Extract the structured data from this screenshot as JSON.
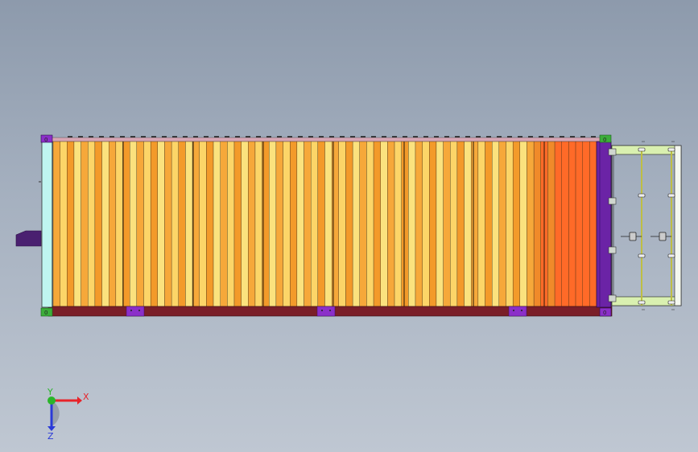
{
  "viewport": {
    "background_top": "#8d9aac",
    "background_bottom": "#bfc7d2"
  },
  "model": {
    "container_frame_color": "#7a1e28",
    "corner_block_color": "#3cae3a",
    "end_panel_color": "#6b23a6",
    "left_end_panel_color": "#bff5f0",
    "fitting_color": "#8b2fc9",
    "slat_palette": [
      "#f6a83a",
      "#fcd568",
      "#f39a2a",
      "#fbe27e",
      "#f08a2a",
      "#ff6a28"
    ],
    "rack_frame_color": "#d9f0b0",
    "rack_rail_color": "#e8e85a",
    "corner_marks": [
      "0",
      "0",
      "0",
      "0"
    ]
  },
  "triad": {
    "x_label": "X",
    "y_label": "Y",
    "z_label": "Z",
    "x_color": "#e8232a",
    "y_color": "#2ab52a",
    "z_color": "#2a3ad8"
  }
}
